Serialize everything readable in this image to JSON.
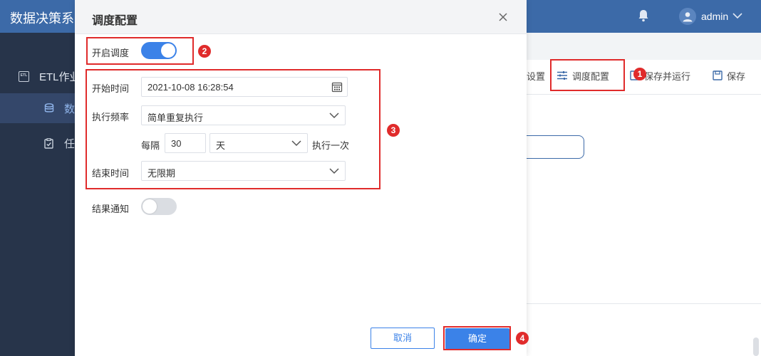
{
  "app": {
    "title": "数据决策系",
    "user": "admin"
  },
  "sidebar": {
    "etl_label": "ETL作业",
    "etl_icon_text": "ETL",
    "data_label": "数",
    "task_label": "任"
  },
  "toolbar": {
    "settings_label": "设置",
    "schedule_label": "调度配置",
    "save_run_label": "保存并运行",
    "save_label": "保存"
  },
  "dialog": {
    "title": "调度配置",
    "enable_label": "开启调度",
    "enable_on": true,
    "start_label": "开始时间",
    "start_value": "2021-10-08 16:28:54",
    "freq_label": "执行频率",
    "freq_value": "简单重复执行",
    "interval_prefix": "每隔",
    "interval_value": "30",
    "interval_unit": "天",
    "interval_suffix": "执行一次",
    "end_label": "结束时间",
    "end_value": "无限期",
    "notify_label": "结果通知",
    "notify_on": false,
    "cancel_label": "取消",
    "ok_label": "确定"
  },
  "badges": {
    "b1": "1",
    "b2": "2",
    "b3": "3",
    "b4": "4"
  },
  "colors": {
    "accent": "#3b82e8",
    "highlight": "#e02b2b",
    "topbar": "#3c6aa8",
    "sidebar": "#27344a"
  }
}
